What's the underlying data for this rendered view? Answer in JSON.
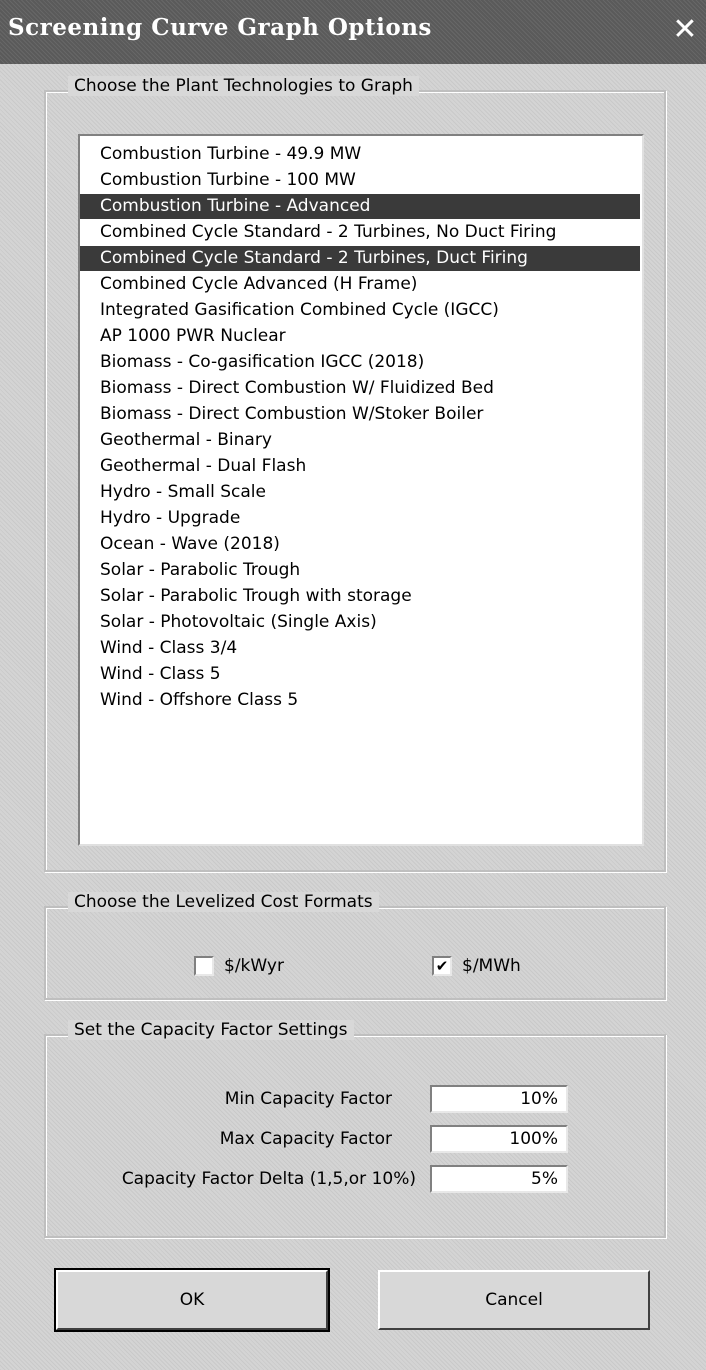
{
  "window": {
    "title": "Screening Curve Graph Options",
    "close_glyph": "✕",
    "close_icon": "close-icon"
  },
  "technologies": {
    "group_label": "Choose the Plant Technologies to Graph",
    "items": [
      {
        "label": "Combustion Turbine - 49.9 MW",
        "selected": false
      },
      {
        "label": "Combustion Turbine - 100 MW",
        "selected": false
      },
      {
        "label": "Combustion Turbine - Advanced",
        "selected": true
      },
      {
        "label": "Combined Cycle Standard - 2 Turbines, No Duct Firing",
        "selected": false
      },
      {
        "label": "Combined Cycle Standard - 2 Turbines, Duct Firing",
        "selected": true
      },
      {
        "label": "Combined Cycle Advanced (H Frame)",
        "selected": false
      },
      {
        "label": "Integrated Gasification Combined Cycle (IGCC)",
        "selected": false
      },
      {
        "label": "AP 1000 PWR Nuclear",
        "selected": false
      },
      {
        "label": "Biomass - Co-gasification IGCC (2018)",
        "selected": false
      },
      {
        "label": "Biomass - Direct Combustion W/ Fluidized Bed",
        "selected": false
      },
      {
        "label": "Biomass - Direct Combustion W/Stoker Boiler",
        "selected": false
      },
      {
        "label": "Geothermal - Binary",
        "selected": false
      },
      {
        "label": "Geothermal - Dual Flash",
        "selected": false
      },
      {
        "label": "Hydro - Small Scale",
        "selected": false
      },
      {
        "label": "Hydro - Upgrade",
        "selected": false
      },
      {
        "label": "Ocean - Wave (2018)",
        "selected": false
      },
      {
        "label": "Solar - Parabolic Trough",
        "selected": false
      },
      {
        "label": "Solar - Parabolic Trough with storage",
        "selected": false
      },
      {
        "label": "Solar - Photovoltaic (Single Axis)",
        "selected": false
      },
      {
        "label": "Wind - Class 3/4",
        "selected": false
      },
      {
        "label": "Wind - Class 5",
        "selected": false
      },
      {
        "label": "Wind - Offshore Class 5",
        "selected": false
      }
    ]
  },
  "formats": {
    "group_label": "Choose the Levelized Cost Formats",
    "kwyr": {
      "label": "$/kWyr",
      "checked": false
    },
    "mwh": {
      "label": "$/MWh",
      "checked": true
    }
  },
  "capacity": {
    "group_label": "Set the Capacity Factor Settings",
    "min": {
      "label": "Min Capacity Factor",
      "value": "10%"
    },
    "max": {
      "label": "Max Capacity Factor",
      "value": "100%"
    },
    "delta": {
      "label": "Capacity Factor Delta (1,5,or 10%)",
      "value": "5%"
    }
  },
  "buttons": {
    "ok": "OK",
    "cancel": "Cancel"
  }
}
